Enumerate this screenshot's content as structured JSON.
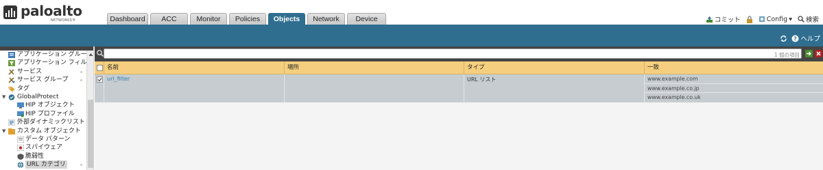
{
  "brand": {
    "name": "paloalto",
    "sub": "NETWORKS®"
  },
  "tabs": [
    {
      "label": "Dashboard"
    },
    {
      "label": "ACC"
    },
    {
      "label": "Monitor"
    },
    {
      "label": "Policies"
    },
    {
      "label": "Objects"
    },
    {
      "label": "Network"
    },
    {
      "label": "Device"
    }
  ],
  "active_tab": "Objects",
  "header_actions": {
    "commit": "コミット",
    "config": "Config",
    "search": "検索"
  },
  "toolbar": {
    "help": "ヘルプ"
  },
  "sidebar": {
    "items": [
      {
        "label": "アプリケーション グループ",
        "icon": "app-group-icon"
      },
      {
        "label": "アプリケーション フィルタ",
        "icon": "app-filter-icon"
      },
      {
        "label": "サービス",
        "icon": "service-icon"
      },
      {
        "label": "サービス グループ",
        "icon": "service-group-icon"
      },
      {
        "label": "タグ",
        "icon": "tag-icon"
      },
      {
        "label": "GlobalProtect",
        "icon": "globalprotect-icon"
      },
      {
        "label": "HIP オブジェクト",
        "icon": "hip-object-icon"
      },
      {
        "label": "HIP プロファイル",
        "icon": "hip-profile-icon"
      },
      {
        "label": "外部ダイナミックリスト",
        "icon": "external-list-icon"
      },
      {
        "label": "カスタム オブジェクト",
        "icon": "custom-object-icon"
      },
      {
        "label": "データ パターン",
        "icon": "data-pattern-icon"
      },
      {
        "label": "スパイウェア",
        "icon": "spyware-icon"
      },
      {
        "label": "脆弱性",
        "icon": "vulnerability-icon"
      },
      {
        "label": "URL カテゴリ",
        "icon": "url-category-icon"
      }
    ]
  },
  "search": {
    "placeholder": "",
    "count": "1 個の項目"
  },
  "table": {
    "columns": [
      "名前",
      "場所",
      "タイプ",
      "一致"
    ],
    "rows": [
      {
        "name": "url_filter",
        "location": "",
        "type": "URL リスト",
        "match": [
          "www.example.com",
          "www.example.co.jp",
          "www.example.co.uk"
        ]
      }
    ]
  }
}
